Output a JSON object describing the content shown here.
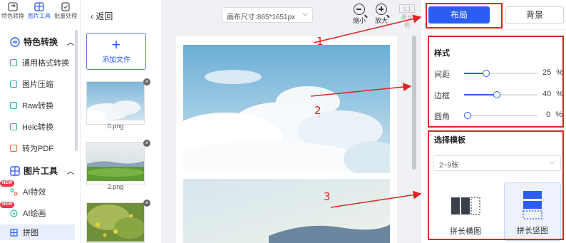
{
  "rail": {
    "tabs": [
      {
        "label": "特色转换",
        "icon": "swap-icon"
      },
      {
        "label": "图片工具",
        "icon": "image-tools-icon"
      },
      {
        "label": "批量处理",
        "icon": "batch-icon"
      }
    ],
    "sections": [
      {
        "label": "特色转换",
        "items": [
          "通用格式转换",
          "图片压缩",
          "Raw转换",
          "Heic转换",
          "转为PDF"
        ]
      },
      {
        "label": "图片工具",
        "items": [
          "AI特效",
          "AI绘画",
          "拼图"
        ]
      }
    ],
    "new_badge": "NEW"
  },
  "thumbs": {
    "back_label": "返回",
    "add_file_label": "添加文件",
    "files": [
      "0.png",
      "2.png"
    ]
  },
  "canvas": {
    "size_select": "画布尺寸:865*1651px",
    "zoom_out": "缩小",
    "zoom_in": "放大",
    "ratio_box": "1:1",
    "ratio_label": "原比例"
  },
  "panel": {
    "tab_layout": "布局",
    "tab_background": "背景",
    "style_title": "样式",
    "sliders": [
      {
        "label": "间距",
        "value": "25",
        "unit": "%",
        "level": 0.25
      },
      {
        "label": "边框",
        "value": "40",
        "unit": "%",
        "level": 0.4
      },
      {
        "label": "圆角",
        "value": "0",
        "unit": "%",
        "level": 0.0
      }
    ],
    "template_title": "选择模板",
    "template_select": "2~9张",
    "templates": [
      "拼长横图",
      "拼长竖图"
    ]
  },
  "annotations": [
    "1",
    "2",
    "3"
  ],
  "colors": {
    "accent": "#2b5df2",
    "annotation": "#e32222"
  }
}
